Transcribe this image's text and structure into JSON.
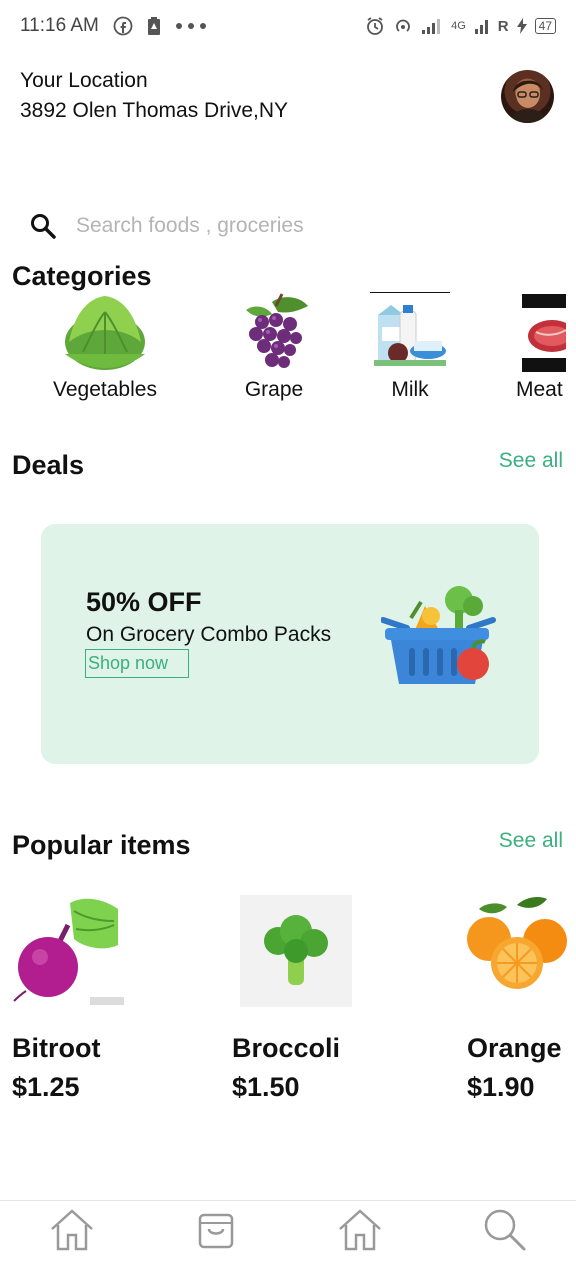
{
  "status_bar": {
    "time": "11:16 AM",
    "signal_label": "R",
    "network": "4G",
    "battery": "47"
  },
  "header": {
    "location_label": "Your Location",
    "address": "3892 Olen Thomas Drive,NY"
  },
  "search": {
    "placeholder": "Search foods , groceries"
  },
  "categories": {
    "title": "Categories",
    "items": [
      {
        "label": "Vegetables",
        "icon": "lettuce-icon"
      },
      {
        "label": "Grape",
        "icon": "grape-icon"
      },
      {
        "label": "Milk",
        "icon": "milk-icon"
      },
      {
        "label": "Meat",
        "icon": "meat-icon"
      }
    ]
  },
  "deals": {
    "title": "Deals",
    "see_all": "See all",
    "card": {
      "headline": "50% OFF",
      "subtitle": "On Grocery Combo Packs",
      "cta": "Shop now"
    }
  },
  "popular": {
    "title": "Popular items",
    "see_all": "See all",
    "items": [
      {
        "name": "Bitroot",
        "price": "$1.25"
      },
      {
        "name": "Broccoli",
        "price": "$1.50"
      },
      {
        "name": "Orange",
        "price": "$1.90"
      }
    ]
  },
  "bottom_nav": {
    "items": [
      "home-icon",
      "shopping-bag-icon",
      "home-icon",
      "search-icon"
    ]
  },
  "colors": {
    "accent": "#3ab07f",
    "deal_bg": "#dff3e8",
    "text": "#111111"
  }
}
